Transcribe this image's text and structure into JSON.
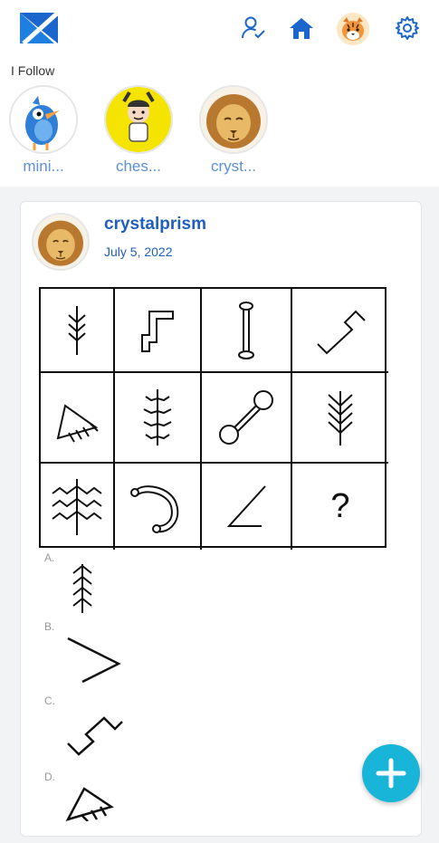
{
  "header": {
    "icons": [
      "logo-icon",
      "user-check-icon",
      "home-icon",
      "tiger-avatar",
      "gear-icon"
    ],
    "accent": "#1a66cc"
  },
  "following": {
    "heading": "I Follow",
    "users": [
      {
        "name": "mini...",
        "avatar": "bird-avatar"
      },
      {
        "name": "ches...",
        "avatar": "cartoon-kid-avatar"
      },
      {
        "name": "cryst...",
        "avatar": "lion-avatar"
      }
    ]
  },
  "post": {
    "author": "crystalprism",
    "date": "July 5, 2022",
    "puzzle": {
      "question_mark": "?",
      "cells": [
        "arrow-tree-figure",
        "step-figure",
        "dumbbell-bar-figure",
        "zigzag-figure",
        "fringe-figure",
        "centipede-figure",
        "barbell-figure",
        "wheat-figure",
        "double-tree-figure",
        "hook-figure",
        "angle-figure",
        "question"
      ]
    },
    "options": [
      {
        "letter": "A."
      },
      {
        "letter": "B."
      },
      {
        "letter": "C."
      },
      {
        "letter": "D."
      }
    ]
  },
  "fab": {
    "icon": "plus-icon",
    "color": "#18b5d8"
  }
}
